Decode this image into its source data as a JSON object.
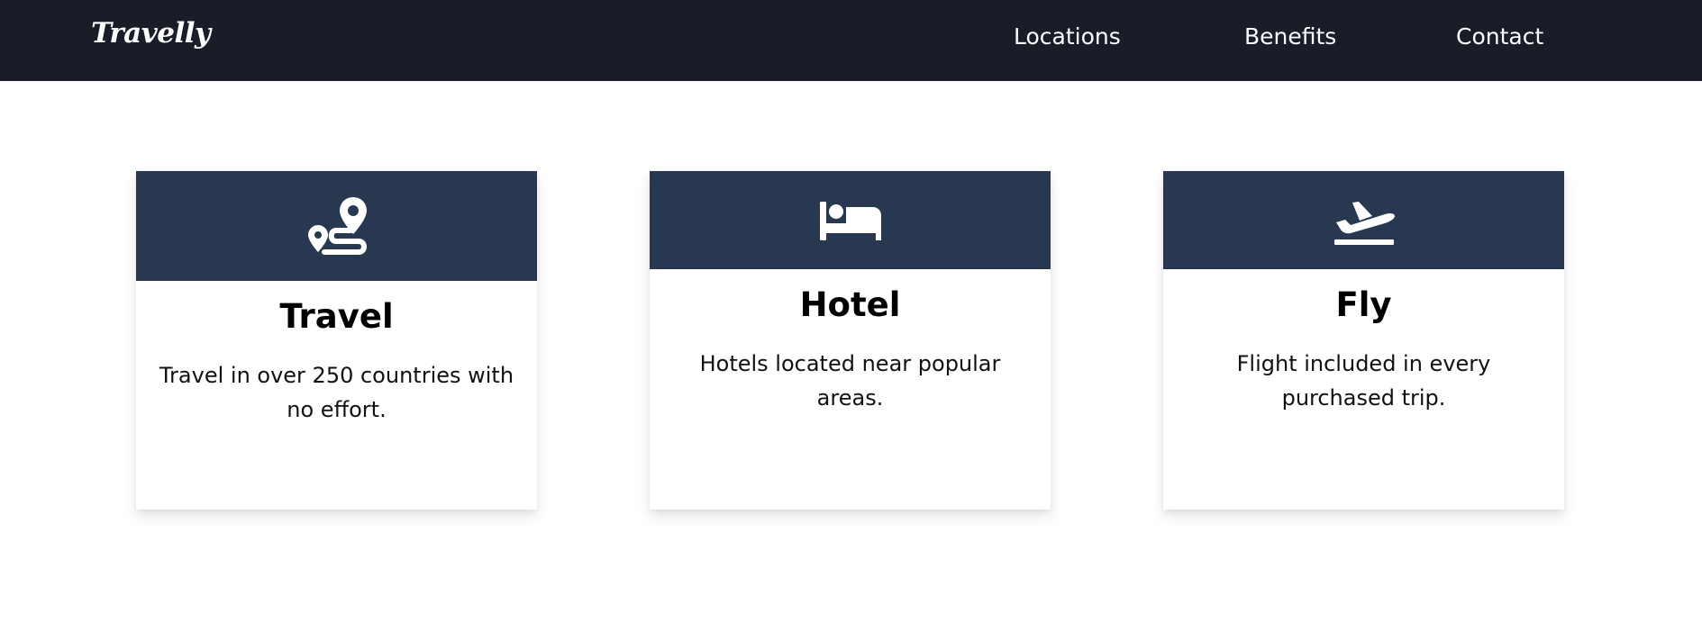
{
  "navbar": {
    "brand": "Travelly",
    "links": [
      {
        "label": "Locations"
      },
      {
        "label": "Benefits"
      },
      {
        "label": "Contact"
      }
    ]
  },
  "cards": [
    {
      "icon": "route-pin-icon",
      "title": "Travel",
      "text": "Travel in over 250 countries with no effort."
    },
    {
      "icon": "bed-icon",
      "title": "Hotel",
      "text": "Hotels located near popular areas."
    },
    {
      "icon": "plane-departure-icon",
      "title": "Fly",
      "text": "Flight included in every purchased trip."
    }
  ],
  "colors": {
    "navbar_bg": "#181d28",
    "card_header_bg": "#273850",
    "text": "#000000",
    "nav_text": "#ffffff"
  }
}
